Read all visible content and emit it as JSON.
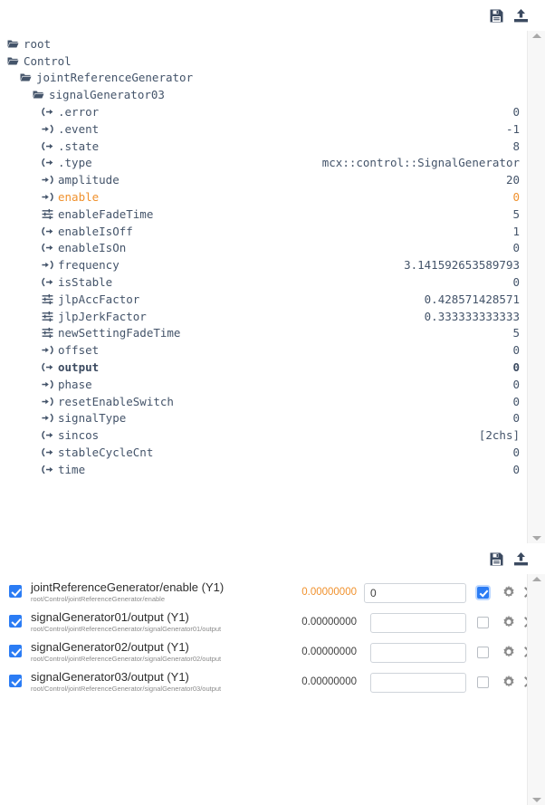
{
  "tree_toolbar": {
    "save_icon": "save-icon",
    "upload_icon": "upload-icon"
  },
  "signal_toolbar": {
    "save_icon": "save-icon",
    "upload_icon": "upload-icon"
  },
  "tree": {
    "rows": [
      {
        "label": "root",
        "value": "",
        "icon": "folder",
        "indent": 0,
        "style": "normal"
      },
      {
        "label": "Control",
        "value": "",
        "icon": "folder",
        "indent": 1,
        "style": "normal"
      },
      {
        "label": "jointReferenceGenerator",
        "value": "",
        "icon": "folder",
        "indent": 2,
        "style": "normal"
      },
      {
        "label": "signalGenerator03",
        "value": "",
        "icon": "folder",
        "indent": 3,
        "style": "normal"
      },
      {
        "label": ".error",
        "value": "0",
        "icon": "output",
        "indent": 4,
        "style": "normal"
      },
      {
        "label": ".event",
        "value": "-1",
        "icon": "input",
        "indent": 4,
        "style": "normal"
      },
      {
        "label": ".state",
        "value": "8",
        "icon": "output",
        "indent": 4,
        "style": "normal"
      },
      {
        "label": ".type",
        "value": "mcx::control::SignalGenerator",
        "icon": "output",
        "indent": 4,
        "style": "normal"
      },
      {
        "label": "amplitude",
        "value": "20",
        "icon": "input",
        "indent": 4,
        "style": "normal"
      },
      {
        "label": "enable",
        "value": "0",
        "icon": "input",
        "indent": 4,
        "style": "highlight"
      },
      {
        "label": "enableFadeTime",
        "value": "5",
        "icon": "param",
        "indent": 4,
        "style": "normal"
      },
      {
        "label": "enableIsOff",
        "value": "1",
        "icon": "output",
        "indent": 4,
        "style": "normal"
      },
      {
        "label": "enableIsOn",
        "value": "0",
        "icon": "output",
        "indent": 4,
        "style": "normal"
      },
      {
        "label": "frequency",
        "value": "3.141592653589793",
        "icon": "input",
        "indent": 4,
        "style": "normal"
      },
      {
        "label": "isStable",
        "value": "0",
        "icon": "output",
        "indent": 4,
        "style": "normal"
      },
      {
        "label": "jlpAccFactor",
        "value": "0.428571428571",
        "icon": "param",
        "indent": 4,
        "style": "normal"
      },
      {
        "label": "jlpJerkFactor",
        "value": "0.333333333333",
        "icon": "param",
        "indent": 4,
        "style": "normal"
      },
      {
        "label": "newSettingFadeTime",
        "value": "5",
        "icon": "param",
        "indent": 4,
        "style": "normal"
      },
      {
        "label": "offset",
        "value": "0",
        "icon": "input",
        "indent": 4,
        "style": "normal"
      },
      {
        "label": "output",
        "value": "0",
        "icon": "output",
        "indent": 4,
        "style": "bold"
      },
      {
        "label": "phase",
        "value": "0",
        "icon": "input",
        "indent": 4,
        "style": "normal"
      },
      {
        "label": "resetEnableSwitch",
        "value": "0",
        "icon": "input",
        "indent": 4,
        "style": "normal"
      },
      {
        "label": "signalType",
        "value": "0",
        "icon": "input",
        "indent": 4,
        "style": "normal"
      },
      {
        "label": "sincos",
        "value": "[2chs]",
        "icon": "output",
        "indent": 4,
        "style": "normal"
      },
      {
        "label": "stableCycleCnt",
        "value": "0",
        "icon": "output",
        "indent": 4,
        "style": "normal"
      },
      {
        "label": "time",
        "value": "0",
        "icon": "output",
        "indent": 4,
        "style": "normal"
      }
    ]
  },
  "signals": {
    "rows": [
      {
        "title": "jointReferenceGenerator/enable (Y1)",
        "path": "root/Control/jointReferenceGenerator/enable",
        "value": "0.00000000",
        "value_accent": true,
        "input_value": "0",
        "enabled": true,
        "toggle_on": true,
        "gear_icon": "gear-icon",
        "close_icon": "close-icon"
      },
      {
        "title": "signalGenerator01/output (Y1)",
        "path": "root/Control/jointReferenceGenerator/signalGenerator01/output",
        "value": "0.00000000",
        "value_accent": false,
        "input_value": "",
        "enabled": true,
        "toggle_on": false,
        "gear_icon": "gear-icon",
        "close_icon": "close-icon"
      },
      {
        "title": "signalGenerator02/output (Y1)",
        "path": "root/Control/jointReferenceGenerator/signalGenerator02/output",
        "value": "0.00000000",
        "value_accent": false,
        "input_value": "",
        "enabled": true,
        "toggle_on": false,
        "gear_icon": "gear-icon",
        "close_icon": "close-icon"
      },
      {
        "title": "signalGenerator03/output (Y1)",
        "path": "root/Control/jointReferenceGenerator/signalGenerator03/output",
        "value": "0.00000000",
        "value_accent": false,
        "input_value": "",
        "enabled": true,
        "toggle_on": false,
        "gear_icon": "gear-icon",
        "close_icon": "close-icon"
      }
    ]
  },
  "colors": {
    "accent_orange": "#f0912d",
    "tree_text": "#44546a",
    "checkbox_blue": "#2b7cf4",
    "icon_dark": "#3b4a60"
  }
}
